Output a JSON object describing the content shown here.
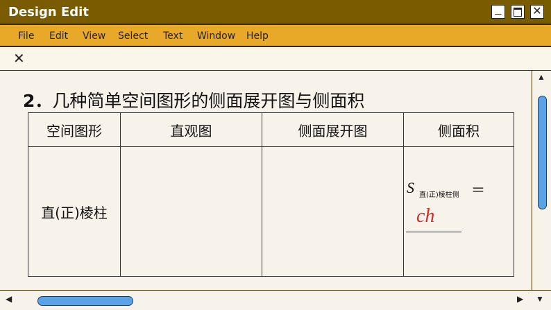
{
  "window": {
    "title": "Design Edit",
    "min_symbol": "_",
    "max_symbol": "□",
    "close_symbol": "✕"
  },
  "menu": [
    "File",
    "Edit",
    "View",
    "Select",
    "Text",
    "Window",
    "Help"
  ],
  "tab": {
    "close_symbol": "✕"
  },
  "document": {
    "heading_number": "2．",
    "heading_text": "几种简单空间图形的侧面展开图与侧面积",
    "table": {
      "headers": [
        "空间图形",
        "直观图",
        "侧面展开图",
        "侧面积"
      ],
      "row": {
        "shape": "直(正)棱柱",
        "formula_symbol": "S",
        "formula_subscript": "直(正)棱柱侧",
        "formula_eq": "＝",
        "answer": "ch"
      }
    }
  },
  "colors": {
    "title_bar": "#7a5c00",
    "menu_bar": "#e8a928",
    "scroll_thumb": "#5aa3e6",
    "answer": "#d42a2a"
  }
}
